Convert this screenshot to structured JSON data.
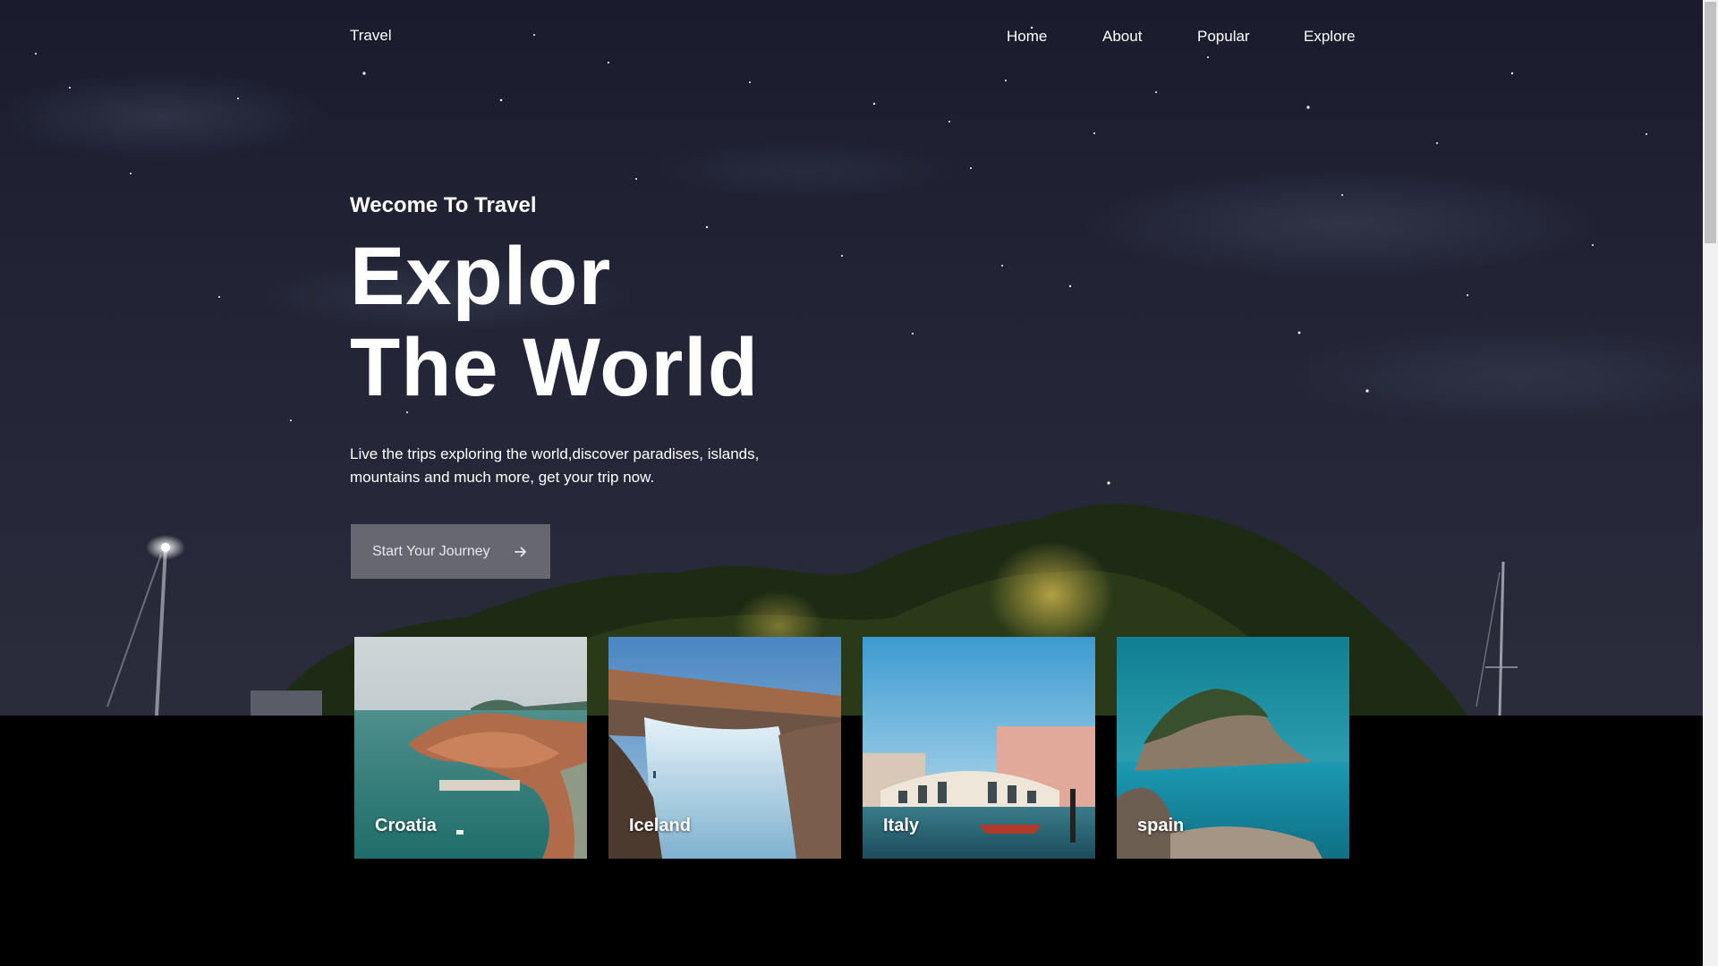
{
  "header": {
    "brand": "Travel",
    "nav": [
      "Home",
      "About",
      "Popular",
      "Explore"
    ]
  },
  "hero": {
    "eyebrow": "Wecome To Travel",
    "title_line1": "Explor",
    "title_line2": "The World",
    "description": "Live the trips exploring the world,discover paradises, islands, mountains and much more, get your trip now.",
    "cta_label": "Start Your Journey",
    "cta_icon": "arrow-right-icon"
  },
  "destinations": [
    {
      "name": "Croatia"
    },
    {
      "name": "Iceland"
    },
    {
      "name": "Italy"
    },
    {
      "name": "spain"
    }
  ]
}
